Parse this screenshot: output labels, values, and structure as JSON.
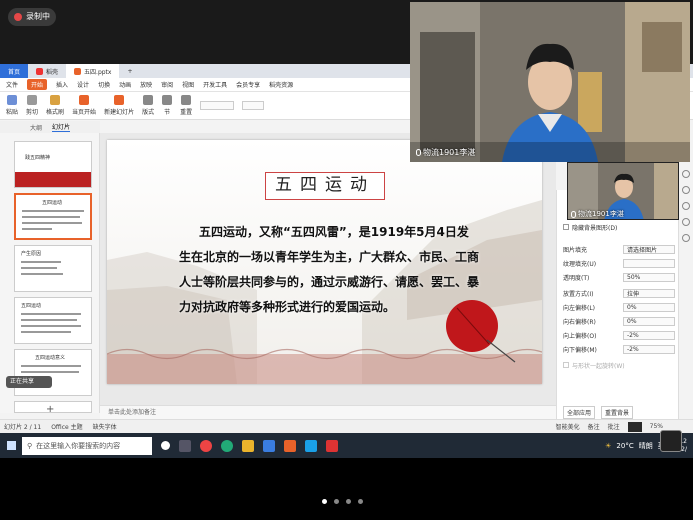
{
  "recording": {
    "label": "录制中"
  },
  "tabs": [
    {
      "label": "首页"
    },
    {
      "label": "稻壳"
    },
    {
      "label": "五四.pptx"
    },
    {
      "label": "+"
    }
  ],
  "menu": [
    "文件",
    "开始",
    "插入",
    "设计",
    "切换",
    "动画",
    "放映",
    "审阅",
    "视图",
    "开发工具",
    "会员专享",
    "稻壳资源"
  ],
  "menu_active": "开始",
  "ribbon": {
    "paste": "粘贴",
    "cut": "剪切",
    "format_painter": "格式刷",
    "from_current": "当页开始",
    "new_slide": "新建幻灯片",
    "layout": "版式",
    "section": "节",
    "reset": "重置"
  },
  "panel_tabs": {
    "outline": "大纲",
    "slides": "幻灯片"
  },
  "thumbs": [
    {
      "num": "1",
      "title": "践五四精神"
    },
    {
      "num": "2",
      "title": "五四运动"
    },
    {
      "num": "3",
      "title": "产生原因"
    },
    {
      "num": "4",
      "title": "五四运动"
    },
    {
      "num": "5",
      "title": "五四运动意义"
    },
    {
      "num": "6",
      "title": ""
    }
  ],
  "presenter_badge": "正在共享",
  "slide": {
    "title": "五四运动",
    "body": "五四运动，又称“五四风雷”，是1919年5月4日发生在北京的一场以青年学生为主，广大群众、市民、工商人士等阶层共同参与的，通过示威游行、请愿、罢工、暴力对抗政府等多种形式进行的爱国运动。"
  },
  "notes_placeholder": "单击此处添加备注",
  "format_pane": {
    "hide_bg": "隐藏背景图形(D)",
    "rows": [
      {
        "label": "图片填充",
        "value": "请选择图片"
      },
      {
        "label": "纹理填充(U)",
        "value": ""
      },
      {
        "label": "透明度(T)",
        "value": "50%"
      },
      {
        "label": "放置方式(I)",
        "value": "拉伸"
      },
      {
        "label": "向左偏移(L)",
        "value": "0%"
      },
      {
        "label": "向右偏移(R)",
        "value": "0%"
      },
      {
        "label": "向上偏移(O)",
        "value": "-2%"
      },
      {
        "label": "向下偏移(M)",
        "value": "-2%"
      }
    ],
    "rotate": "与形状一起旋转(W)",
    "apply_all": "全部应用",
    "reset_bg": "重置背景"
  },
  "status": {
    "slide_count": "幻灯片 2 / 11",
    "theme": "Office 主题",
    "font_missing": "缺失字体",
    "smart_beautify": "智能美化",
    "notes": "备注",
    "comment": "批注",
    "zoom": "75%"
  },
  "taskbar": {
    "search_placeholder": "在这里输入你要搜索的内容",
    "temp": "20°C",
    "weather": "晴朗",
    "ime": "英",
    "time": "15:12",
    "date": "2022/"
  },
  "camera": {
    "main_name": "物流1901李湛",
    "small_name": "物流1901李湛"
  },
  "page_dots": 4,
  "page_dot_active": 0
}
